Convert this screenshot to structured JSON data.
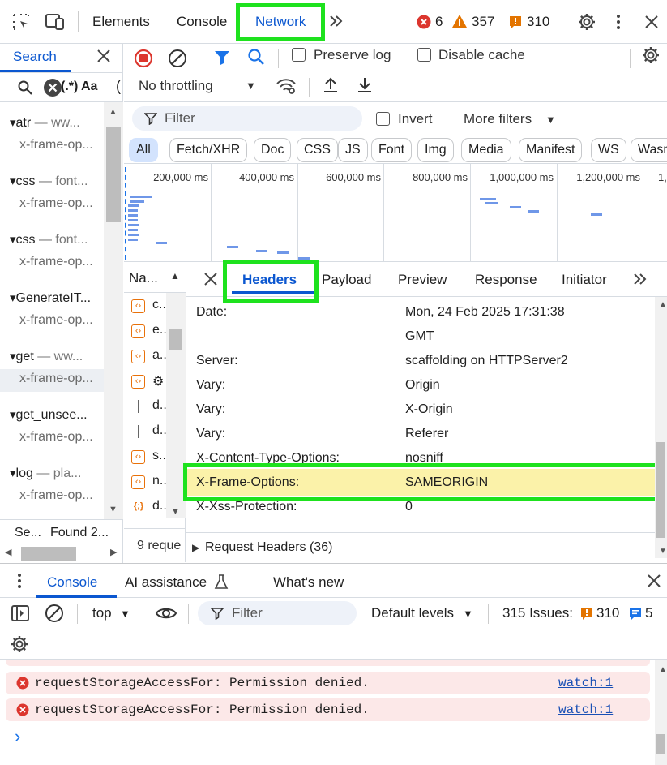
{
  "topbar": {
    "tabs": [
      "Elements",
      "Console",
      "Network"
    ],
    "active_tab": "Network",
    "errors": "6",
    "warnings": "357",
    "issues": "310"
  },
  "search": {
    "tab_label": "Search",
    "regex_label": ".*",
    "case_label": "Aa",
    "results": [
      {
        "name": "atr",
        "domain": "ww...",
        "match": "x-frame-op..."
      },
      {
        "name": "css",
        "domain": "font...",
        "match": "x-frame-op..."
      },
      {
        "name": "css",
        "domain": "font...",
        "match": "x-frame-op..."
      },
      {
        "name": "GenerateIT...",
        "domain": "",
        "match": "x-frame-op..."
      },
      {
        "name": "get",
        "domain": "ww...",
        "match": "x-frame-op..."
      },
      {
        "name": "get_unsee...",
        "domain": "",
        "match": "x-frame-op..."
      },
      {
        "name": "log",
        "domain": "pla...",
        "match": "x-frame-op..."
      }
    ],
    "status": "Se...",
    "found": "Found 2..."
  },
  "network": {
    "preserve_log": "Preserve log",
    "disable_cache": "Disable cache",
    "throttling": "No throttling",
    "filter_placeholder": "Filter",
    "invert": "Invert",
    "more_filters": "More filters",
    "type_filters": [
      "All",
      "Fetch/XHR",
      "Doc",
      "CSS",
      "JS",
      "Font",
      "Img",
      "Media",
      "Manifest",
      "WS",
      "Wasm"
    ],
    "timeline_ticks": [
      "200,000 ms",
      "400,000 ms",
      "600,000 ms",
      "800,000 ms",
      "1,000,000 ms",
      "1,200,000 ms",
      "1,"
    ],
    "name_column": "Na...",
    "requests": [
      {
        "icon": "code-icon",
        "name": "c..."
      },
      {
        "icon": "code-icon",
        "name": "e..."
      },
      {
        "icon": "code-icon",
        "name": "a..."
      },
      {
        "icon": "code-gear-icon",
        "name": "⚙"
      },
      {
        "icon": "doc-icon",
        "name": "d..."
      },
      {
        "icon": "doc-icon",
        "name": "d..."
      },
      {
        "icon": "code-icon",
        "name": "s..."
      },
      {
        "icon": "code-icon",
        "name": "n..."
      },
      {
        "icon": "json-icon",
        "name": "d..."
      }
    ],
    "request_count": "9 reque",
    "detail_tabs": [
      "Headers",
      "Payload",
      "Preview",
      "Response",
      "Initiator"
    ],
    "headers": [
      {
        "name": "Date:",
        "value": "Mon, 24 Feb 2025 17:31:38"
      },
      {
        "name": "",
        "value": "GMT"
      },
      {
        "name": "Server:",
        "value": "scaffolding on HTTPServer2"
      },
      {
        "name": "Vary:",
        "value": "Origin"
      },
      {
        "name": "Vary:",
        "value": "X-Origin"
      },
      {
        "name": "Vary:",
        "value": "Referer"
      },
      {
        "name": "X-Content-Type-Options:",
        "value": "nosniff"
      },
      {
        "name": "X-Frame-Options:",
        "value": "SAMEORIGIN"
      },
      {
        "name": "X-Xss-Protection:",
        "value": "0"
      }
    ],
    "request_headers": "Request Headers (36)"
  },
  "drawer": {
    "tabs": [
      "Console",
      "AI assistance",
      "What's new"
    ],
    "context": "top",
    "filter_placeholder": "Filter",
    "levels": "Default levels",
    "issues_label": "315 Issues:",
    "issues_count": "310",
    "messages_count": "5",
    "messages": [
      {
        "text": "requestStorageAccessFor: Permission denied.",
        "link": "watch:1"
      },
      {
        "text": "requestStorageAccessFor: Permission denied.",
        "link": "watch:1"
      }
    ],
    "prompt": "›"
  },
  "colors": {
    "highlight": "#1ee21e",
    "accent": "#0b57d0",
    "error": "#dc362e",
    "warning": "#e37400"
  }
}
